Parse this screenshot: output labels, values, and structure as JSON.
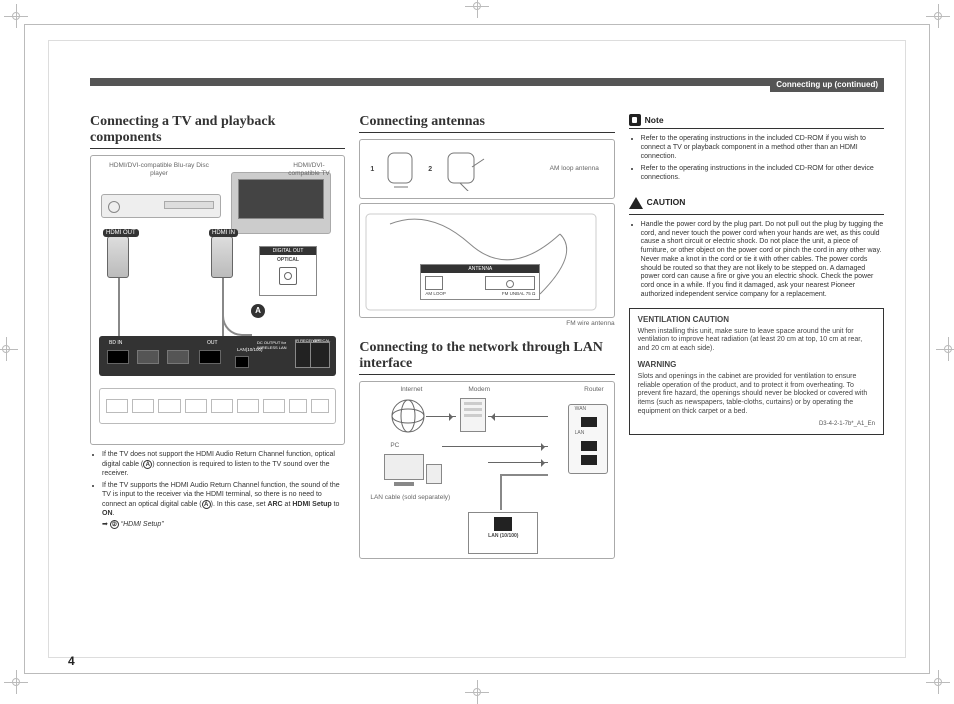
{
  "header": {
    "tab": "Connecting up (continued)"
  },
  "page_number": "4",
  "col1": {
    "heading": "Connecting a TV and playback components",
    "bd_label": "HDMI/DVI-compatible Blu-ray Disc player",
    "tv_label": "HDMI/DVI-compatible TV",
    "hdmi_out": "HDMI OUT",
    "hdmi_in": "HDMI IN",
    "digital_out": "DIGITAL OUT",
    "optical": "OPTICAL",
    "badge_a": "A",
    "bd_in": "BD IN",
    "out": "OUT",
    "lan": "LAN(10/100)",
    "dc_out": "DC OUTPUT for WIRELESS LAN",
    "irrev": "IR RECEIVER",
    "note1": "If the TV does not support the HDMI Audio Return Channel function, optical digital cable (",
    "note1b": ") connection is required to listen to the TV sound over the receiver.",
    "note2": "If the TV supports the HDMI Audio Return Channel function, the sound of the TV is input to the receiver via the HDMI terminal, so there is no need to connect an optical digital cable (",
    "note2b": "). In this case, set ",
    "arc": "ARC",
    "at": " at ",
    "hdmi_setup": "HDMI Setup",
    "to": " to ",
    "on": "ON",
    "note2c": ".",
    "arrow_ref": "“HDMI Setup”"
  },
  "col2": {
    "heading_ant": "Connecting antennas",
    "am_label": "AM loop antenna",
    "fm_label": "FM wire antenna",
    "step1": "1",
    "step2": "2",
    "antenna_box_title": "ANTENNA",
    "am_loop": "AM LOOP",
    "fm_unbal": "FM UNBAL 75 Ω",
    "heading_lan": "Connecting to the network through LAN interface",
    "internet": "Internet",
    "modem": "Modem",
    "router": "Router",
    "pc": "PC",
    "wan": "WAN",
    "lan": "LAN",
    "lan_cable": "LAN cable (sold separately)",
    "lan_port": "LAN (10/100)"
  },
  "col3": {
    "note_head": "Note",
    "note1": "Refer to the operating instructions in the included CD-ROM if you wish to connect a TV or playback component in a method other than an HDMI connection.",
    "note2": "Refer to the operating instructions in the included CD-ROM for other device connections.",
    "caution_head": "CAUTION",
    "caution_body": "Handle the power cord by the plug part. Do not pull out the plug by tugging the cord, and never touch the power cord when your hands are wet, as this could cause a short circuit or electric shock. Do not place the unit, a piece of furniture, or other object on the power cord or pinch the cord in any other way. Never make a knot in the cord or tie it with other cables. The power cords should be routed so that they are not likely to be stepped on. A damaged power cord can cause a fire or give you an electric shock. Check the power cord once in a while. If you find it damaged, ask your nearest Pioneer authorized independent service company for a replacement.",
    "vent_head": "VENTILATION CAUTION",
    "vent_body": "When installing this unit, make sure to leave space around the unit for ventilation to improve heat radiation (at least 20 cm at top, 10 cm at rear, and 20 cm at each side).",
    "warn_head": "WARNING",
    "warn_body": "Slots and openings in the cabinet are provided for ventilation to ensure reliable operation of the product, and to protect it from overheating. To prevent fire hazard, the openings should never be blocked or covered with items (such as newspapers, table-cloths, curtains) or by operating the equipment on thick carpet or a bed.",
    "code": "D3-4-2-1-7b*_A1_En"
  }
}
